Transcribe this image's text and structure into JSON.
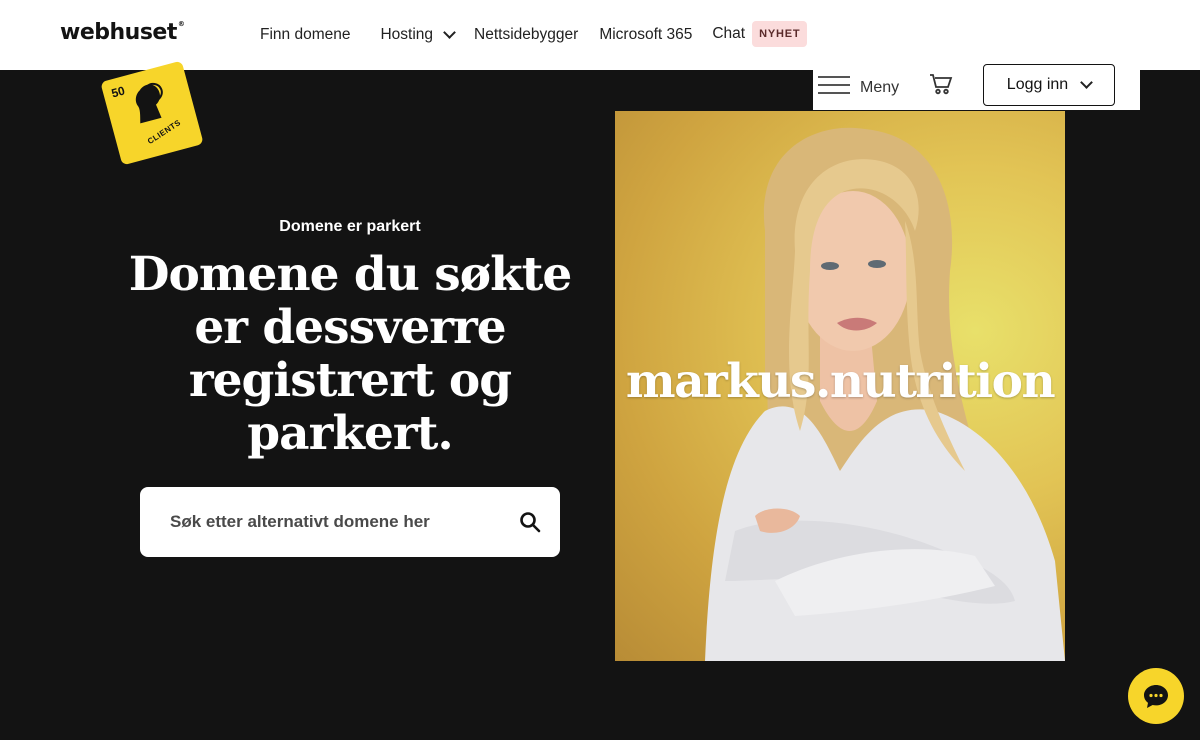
{
  "header": {
    "logo": "webhuset",
    "nav": [
      {
        "label": "Finn domene"
      },
      {
        "label": "Hosting"
      },
      {
        "label": "Nettsidebygger"
      },
      {
        "label": "Microsoft 365"
      },
      {
        "label": "Chat",
        "badge": "NYHET"
      }
    ],
    "menu_label": "Meny",
    "login_label": "Logg inn"
  },
  "sticker": {
    "number": "50",
    "text": "CLIENTS"
  },
  "hero": {
    "eyebrow": "Domene er parkert",
    "headline": "Domene du søkte er dessverre registrert og parkert.",
    "search_placeholder": "Søk etter alternativt domene her",
    "domain": "markus.nutrition"
  },
  "colors": {
    "accent": "#f7d52a",
    "background": "#131313",
    "badge_bg": "#fbdcdc"
  },
  "icons": {
    "search": "search-icon",
    "cart": "cart-icon",
    "menu": "hamburger-icon",
    "chat": "chat-bubble-icon"
  }
}
